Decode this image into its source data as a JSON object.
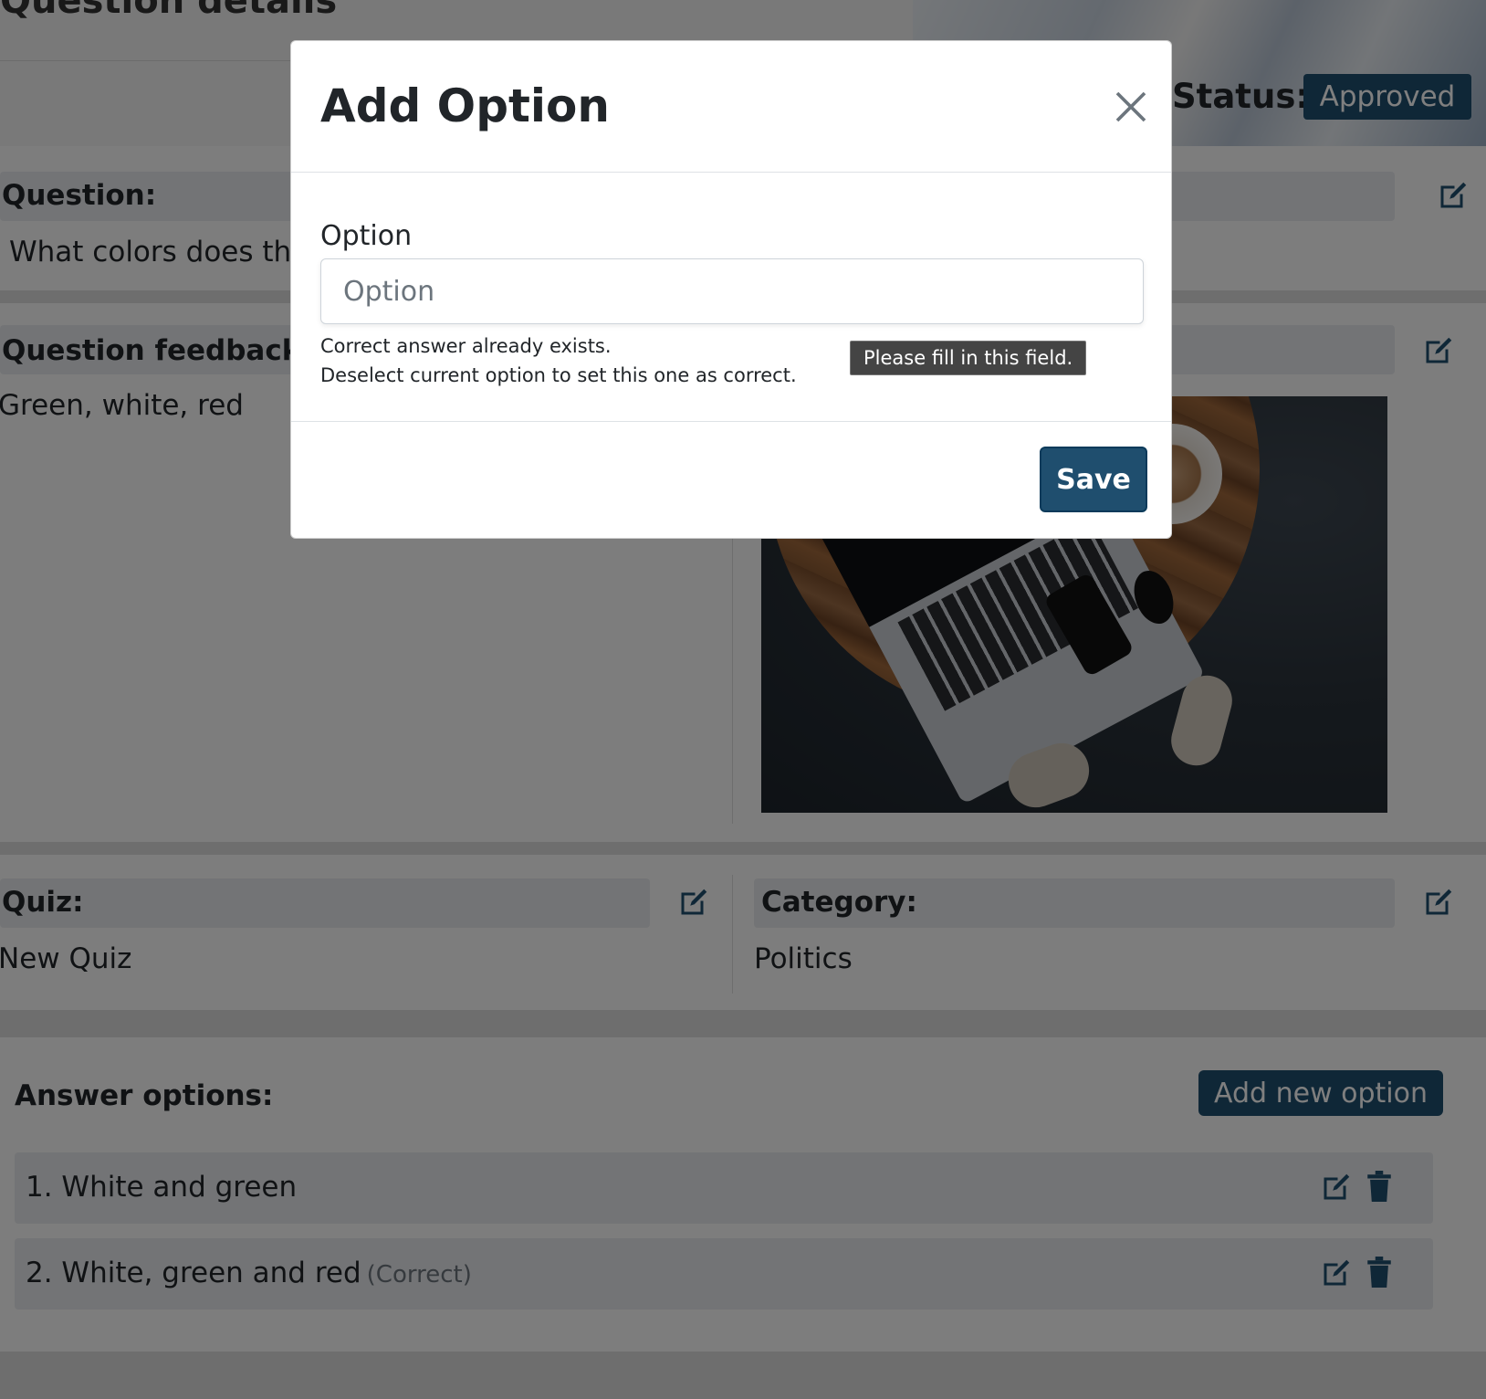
{
  "header": {
    "title": "Question details",
    "status_label": "Status:",
    "status_value": "Approved"
  },
  "question": {
    "label": "Question:",
    "text": "What colors does the"
  },
  "feedback": {
    "label": "Question feedback:",
    "text": "Green, white, red"
  },
  "quiz": {
    "label": "Quiz:",
    "value": "New Quiz"
  },
  "category": {
    "label": "Category:",
    "value": "Politics"
  },
  "answers": {
    "heading": "Answer options:",
    "add_button": "Add new option",
    "items": [
      {
        "text": "1. White and green",
        "correct_tag": ""
      },
      {
        "text": "2. White, green and red",
        "correct_tag": "(Correct)"
      }
    ]
  },
  "modal": {
    "title": "Add Option",
    "field_label": "Option",
    "input_value": "",
    "input_placeholder": "Option",
    "help_line_1": "Correct answer already exists.",
    "help_line_2": "Deselect current option to set this one as correct.",
    "tooltip": "Please fill in this field.",
    "save_label": "Save"
  },
  "icons": {
    "edit": "edit-icon",
    "trash": "trash-icon",
    "close": "close-icon"
  },
  "colors": {
    "primary": "#1f4e6e",
    "overlay": "rgba(0,0,0,0.5)"
  }
}
